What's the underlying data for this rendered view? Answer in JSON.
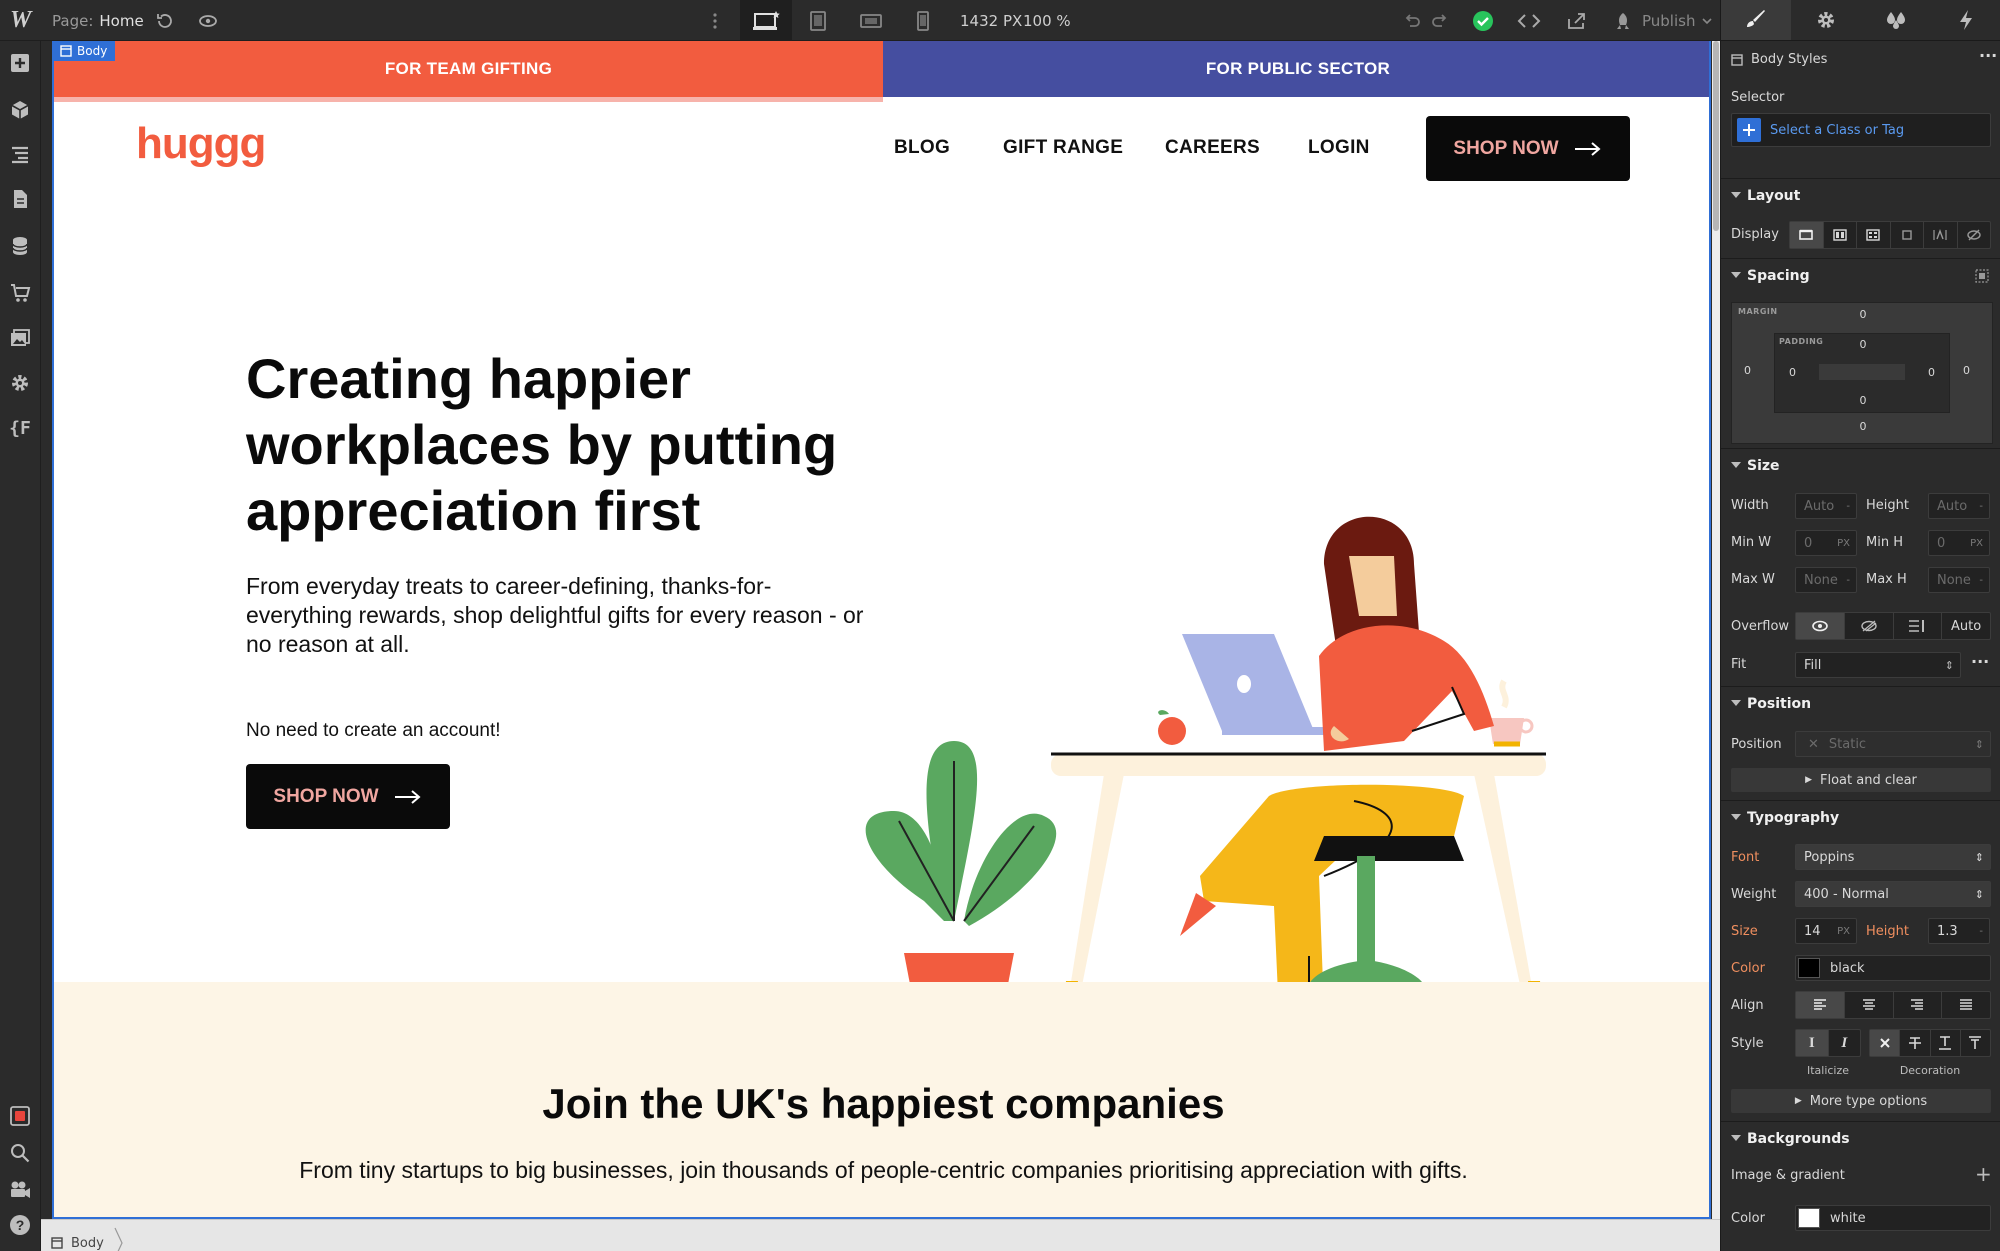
{
  "app": {
    "logo": "W",
    "page_label": "Page:",
    "page_name": "Home",
    "viewport_width": "1432 PX",
    "zoom": "100 %",
    "publish_label": "Publish"
  },
  "canvas": {
    "selected_tag": "Body",
    "breadcrumb": "Body"
  },
  "site": {
    "banner_left": "FOR TEAM GIFTING",
    "banner_right": "FOR PUBLIC SECTOR",
    "banner_left_color": "#f25c3f",
    "banner_right_color": "#454ea0",
    "logo": "huggg",
    "nav": [
      "BLOG",
      "GIFT RANGE",
      "CAREERS",
      "LOGIN"
    ],
    "shop_now": "SHOP NOW",
    "hero_title": "Creating happier workplaces by putting appreciation first",
    "hero_subtitle": "From everyday treats to career-defining, thanks-for-everything rewards, shop delightful gifts for every reason - or no reason at all.",
    "no_account": "No need to create an account!",
    "section_title": "Join the UK's happiest companies",
    "section_text": "From tiny startups to big businesses, join thousands of people-centric companies prioritising appreciation with gifts."
  },
  "panel": {
    "title": "Body Styles",
    "selector_label": "Selector",
    "selector_placeholder": "Select a Class or Tag",
    "layout": {
      "heading": "Layout",
      "display_label": "Display"
    },
    "spacing": {
      "heading": "Spacing",
      "margin_label": "MARGIN",
      "padding_label": "PADDING",
      "margin": {
        "top": "0",
        "right": "0",
        "bottom": "0",
        "left": "0"
      },
      "padding": {
        "top": "0",
        "right": "0",
        "bottom": "0",
        "left": "0"
      }
    },
    "size": {
      "heading": "Size",
      "width_label": "Width",
      "width_value": "Auto",
      "height_label": "Height",
      "height_value": "Auto",
      "minw_label": "Min W",
      "minw_value": "0",
      "minh_label": "Min H",
      "minh_value": "0",
      "maxw_label": "Max W",
      "maxw_value": "None",
      "maxh_label": "Max H",
      "maxh_value": "None",
      "unit": "PX",
      "overflow_label": "Overflow",
      "overflow_auto": "Auto",
      "fit_label": "Fit",
      "fit_value": "Fill"
    },
    "position": {
      "heading": "Position",
      "position_label": "Position",
      "position_value": "Static",
      "float_clear": "Float and clear"
    },
    "typography": {
      "heading": "Typography",
      "font_label": "Font",
      "font_value": "Poppins",
      "weight_label": "Weight",
      "weight_value": "400 - Normal",
      "size_label": "Size",
      "size_value": "14",
      "size_unit": "PX",
      "height_label": "Height",
      "height_value": "1.3",
      "color_label": "Color",
      "color_value": "black",
      "align_label": "Align",
      "style_label": "Style",
      "italicize": "Italicize",
      "decoration": "Decoration",
      "more": "More type options"
    },
    "backgrounds": {
      "heading": "Backgrounds",
      "image_gradient": "Image & gradient",
      "color_label": "Color",
      "color_value": "white"
    }
  }
}
